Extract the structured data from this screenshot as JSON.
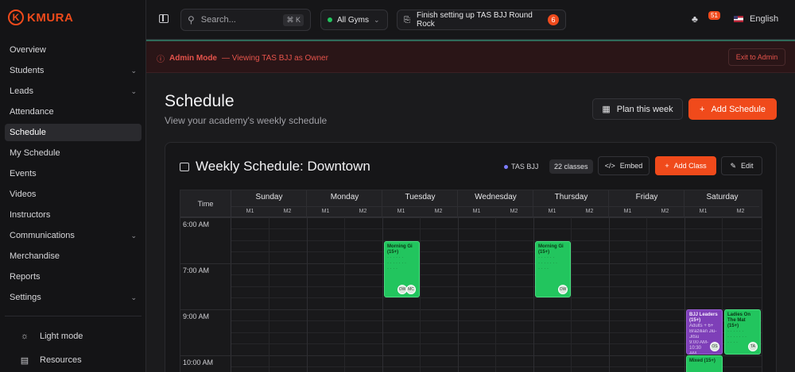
{
  "brand": {
    "logo_letter": "K",
    "name": "KMURA"
  },
  "sidebar": {
    "items": [
      {
        "label": "Overview",
        "chevron": false
      },
      {
        "label": "Students",
        "chevron": true
      },
      {
        "label": "Leads",
        "chevron": true
      },
      {
        "label": "Attendance",
        "chevron": false
      },
      {
        "label": "Schedule",
        "chevron": false,
        "active": true
      },
      {
        "label": "My Schedule",
        "chevron": false
      },
      {
        "label": "Events",
        "chevron": false
      },
      {
        "label": "Videos",
        "chevron": false
      },
      {
        "label": "Instructors",
        "chevron": false
      },
      {
        "label": "Communications",
        "chevron": true
      },
      {
        "label": "Merchandise",
        "chevron": false
      },
      {
        "label": "Reports",
        "chevron": false
      },
      {
        "label": "Settings",
        "chevron": true
      }
    ],
    "bottom": [
      {
        "label": "Light mode",
        "icon": "sun-icon"
      },
      {
        "label": "Resources",
        "icon": "book-icon"
      }
    ]
  },
  "topbar": {
    "search_placeholder": "Search...",
    "search_shortcut": "⌘ K",
    "gym_filter": "All Gyms",
    "setup_task": "Finish setting up TAS BJJ Round Rock",
    "setup_count": "6",
    "notifications_count": "51",
    "language": "English"
  },
  "admin_banner": {
    "mode": "Admin Mode",
    "text": "— Viewing TAS BJJ as Owner",
    "exit_label": "Exit to Admin"
  },
  "page": {
    "title": "Schedule",
    "subtitle": "View your academy's weekly schedule",
    "plan_label": "Plan this week",
    "add_schedule_label": "Add Schedule"
  },
  "card": {
    "title": "Weekly Schedule: Downtown",
    "gym_tag": "TAS BJJ",
    "class_count": "22 classes",
    "embed_label": "Embed",
    "add_class_label": "Add Class",
    "edit_label": "Edit"
  },
  "grid": {
    "time_header": "Time",
    "days": [
      "Sunday",
      "Monday",
      "Tuesday",
      "Wednesday",
      "Thursday",
      "Friday",
      "Saturday"
    ],
    "sub_columns": [
      "M1",
      "M2"
    ],
    "time_labels": [
      "6:00 AM",
      "7:00 AM",
      "9:00 AM",
      "10:00 AM"
    ]
  },
  "events": [
    {
      "title": "Morning Gi (15+)",
      "details": [
        "· · · · · ·",
        "· · · · · · ·",
        "· · · ·"
      ],
      "avatars": [
        "OW",
        "MC"
      ],
      "color": "#22c55e"
    },
    {
      "title": "Morning Gi (15+)",
      "details": [
        "· · · · · ·",
        "· · · · · · ·",
        "· · · ·"
      ],
      "avatars": [
        "OW"
      ],
      "color": "#22c55e"
    },
    {
      "title": "BJJ Leaders (15+)",
      "details": [
        "Adults + 6+",
        "Brazilian Jiu-",
        "Jitsu",
        "9:00 AM-10:30",
        "AM"
      ],
      "avatars": [
        "OS"
      ],
      "color": "#7e3fb8"
    },
    {
      "title": "Ladies On The Mat (15+)",
      "details": [
        "· · · · · ·",
        "· · · · · · ·",
        "· · · ·"
      ],
      "avatars": [
        "TA"
      ],
      "color": "#22c55e"
    },
    {
      "title": "Mixed (15+)",
      "details": [],
      "avatars": [],
      "color": "#22c55e"
    }
  ]
}
